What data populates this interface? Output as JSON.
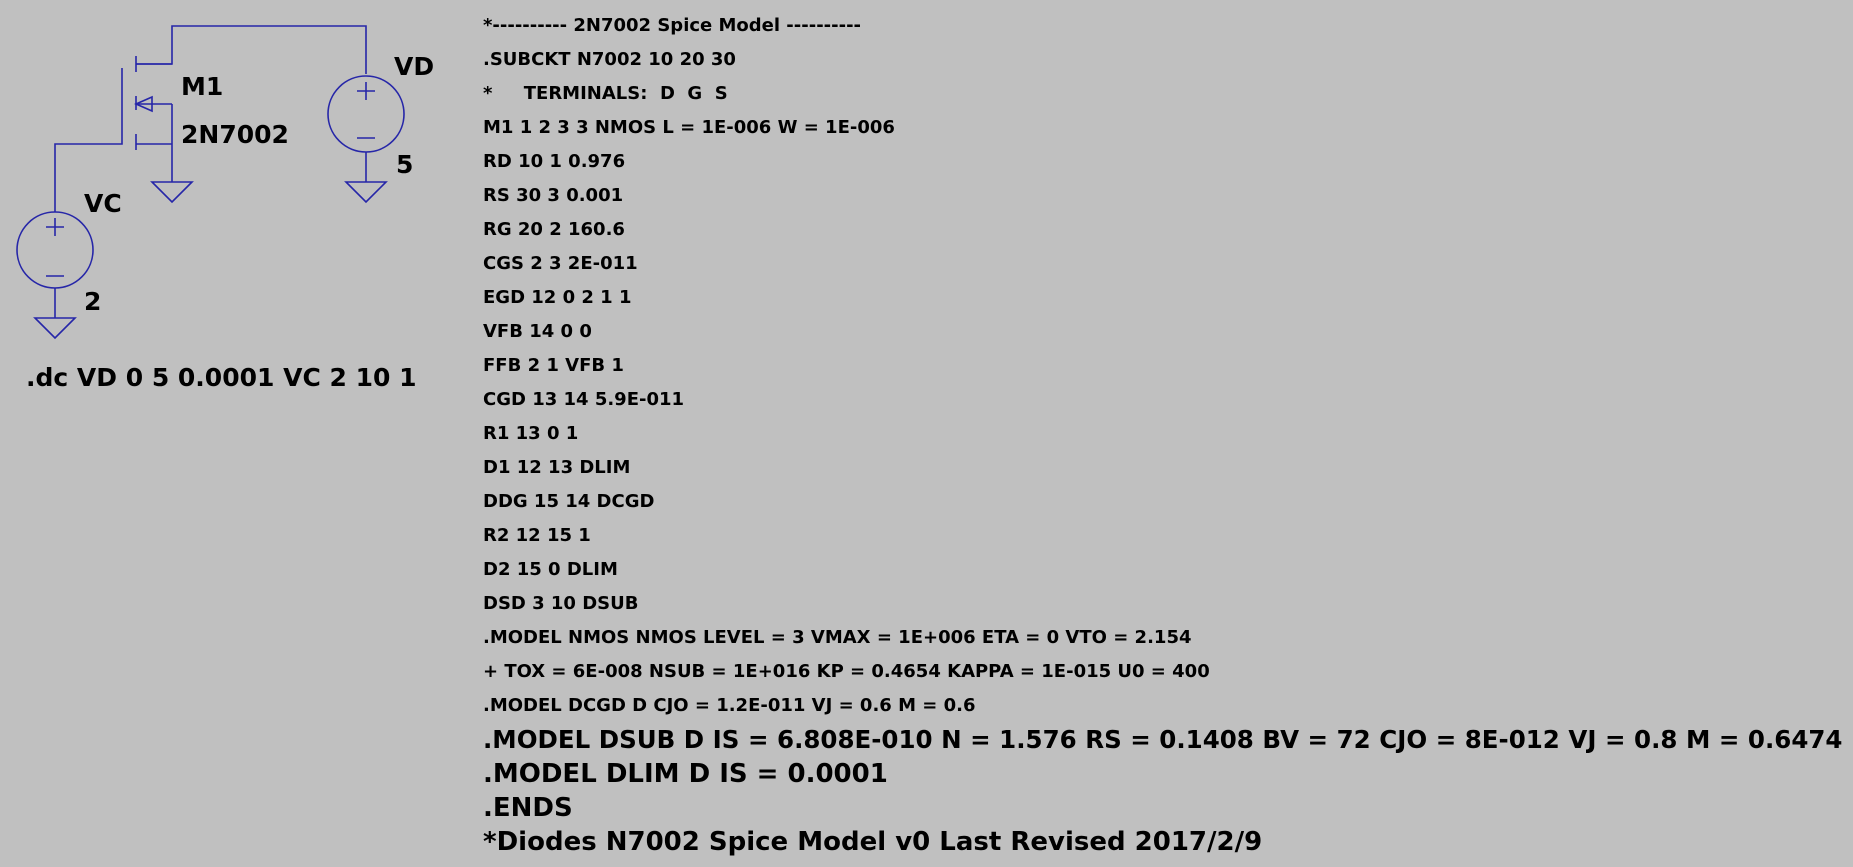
{
  "schematic": {
    "labels": {
      "m1_name": "M1",
      "m1_model": "2N7002",
      "vd_name": "VD",
      "vd_value": "5",
      "vc_name": "VC",
      "vc_value": "2"
    },
    "directive": ".dc VD 0 5 0.0001 VC 2 10 1"
  },
  "netlist": [
    "*---------- 2N7002 Spice Model ----------",
    ".SUBCKT N7002 10 20 30",
    "*     TERMINALS:  D  G  S",
    "M1 1 2 3 3 NMOS L = 1E-006 W = 1E-006",
    "RD 10 1 0.976",
    "RS 30 3 0.001",
    "RG 20 2 160.6",
    "CGS 2 3 2E-011",
    "EGD 12 0 2 1 1",
    "VFB 14 0 0",
    "FFB 2 1 VFB 1",
    "CGD 13 14 5.9E-011",
    "R1 13 0 1",
    "D1 12 13 DLIM",
    "DDG 15 14 DCGD",
    "R2 12 15 1",
    "D2 15 0 DLIM",
    "DSD 3 10 DSUB",
    ".MODEL NMOS NMOS LEVEL = 3 VMAX = 1E+006 ETA = 0 VTO = 2.154",
    "+ TOX = 6E-008 NSUB = 1E+016 KP = 0.4654 KAPPA = 1E-015 U0 = 400",
    ".MODEL DCGD D CJO = 1.2E-011 VJ = 0.6 M = 0.6",
    ".MODEL DSUB D IS = 6.808E-010 N = 1.576 RS = 0.1408 BV = 72 CJO = 8E-012 VJ = 0.8 M = 0.6474",
    ".MODEL DLIM D IS = 0.0001",
    ".ENDS",
    "*Diodes N7002 Spice Model v0 Last Revised 2017/2/9"
  ],
  "colors": {
    "background": "#c0c0c0",
    "wire": "#2626a8",
    "text": "#000000"
  },
  "icons": [
    "nmos-transistor-icon",
    "voltage-source-icon",
    "ground-icon"
  ]
}
